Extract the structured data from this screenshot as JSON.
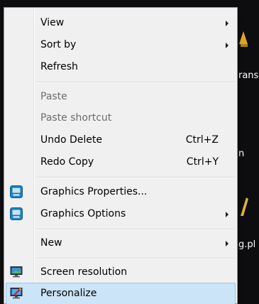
{
  "desktop": {
    "behind_labels": [
      "rans",
      "n",
      "g.pl"
    ]
  },
  "context_menu": {
    "view": {
      "label": "View",
      "has_submenu": true
    },
    "sort_by": {
      "label": "Sort by",
      "has_submenu": true
    },
    "refresh": {
      "label": "Refresh"
    },
    "paste": {
      "label": "Paste",
      "enabled": false
    },
    "paste_shortcut": {
      "label": "Paste shortcut",
      "enabled": false
    },
    "undo_delete": {
      "label": "Undo Delete",
      "shortcut": "Ctrl+Z"
    },
    "redo_copy": {
      "label": "Redo Copy",
      "shortcut": "Ctrl+Y"
    },
    "graphics_properties": {
      "label": "Graphics Properties...",
      "icon": "intel-graphics-icon"
    },
    "graphics_options": {
      "label": "Graphics Options",
      "has_submenu": true,
      "icon": "intel-graphics-icon"
    },
    "new": {
      "label": "New",
      "has_submenu": true
    },
    "screen_resolution": {
      "label": "Screen resolution",
      "icon": "monitor-icon"
    },
    "personalize": {
      "label": "Personalize",
      "icon": "personalize-icon",
      "highlighted": true
    }
  },
  "colors": {
    "menu_background": "#f0f0f0",
    "highlight_fill": "#cce4f7",
    "highlight_border": "#99c6ea",
    "disabled_text": "#6d6d6d",
    "desktop_background": "#0d0d10"
  }
}
